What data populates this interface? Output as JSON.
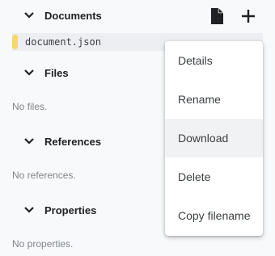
{
  "sections": {
    "documents": {
      "title": "Documents"
    },
    "files": {
      "title": "Files",
      "empty": "No files."
    },
    "references": {
      "title": "References",
      "empty": "No references."
    },
    "properties": {
      "title": "Properties",
      "empty": "No properties."
    }
  },
  "documents_list": [
    {
      "name": "document.json",
      "marker_color": "#f4d86a"
    }
  ],
  "toolbar": {
    "new_document_icon": "file-icon",
    "add_icon": "plus-icon"
  },
  "context_menu": {
    "items": [
      {
        "label": "Details"
      },
      {
        "label": "Rename"
      },
      {
        "label": "Download",
        "highlighted": true
      },
      {
        "label": "Delete"
      },
      {
        "label": "Copy filename"
      }
    ]
  },
  "colors": {
    "accent_marker": "#f4d86a",
    "muted_text": "#80868b",
    "menu_highlight": "#f1f2f4"
  }
}
